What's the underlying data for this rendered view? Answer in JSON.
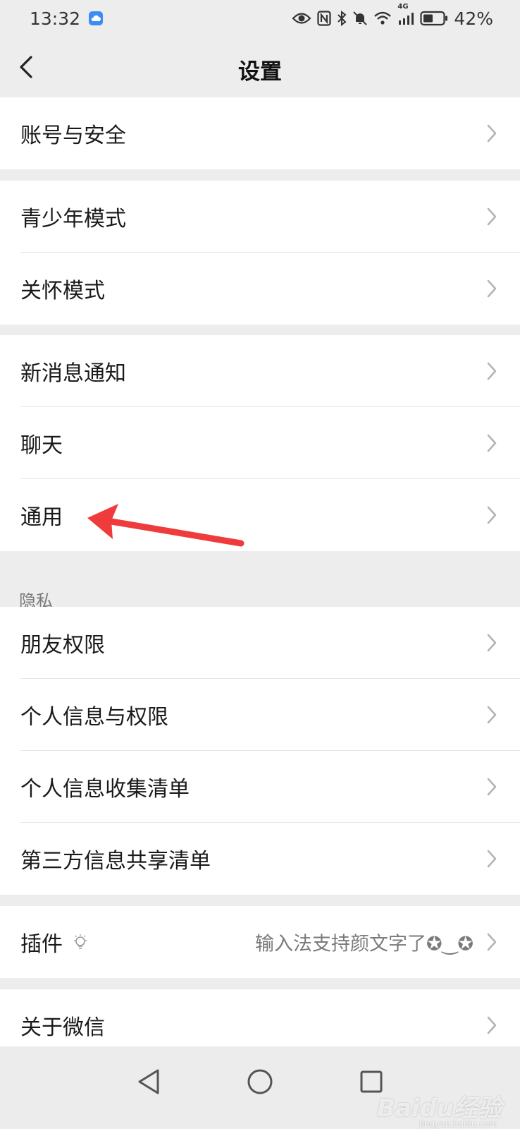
{
  "status_bar": {
    "time": "13:32",
    "battery": "42%",
    "network": "4G",
    "icons": [
      "cloud-icon",
      "eye-icon",
      "nfc-icon",
      "bluetooth-icon",
      "mute-icon",
      "wifi-icon",
      "signal-icon",
      "battery-icon"
    ]
  },
  "header": {
    "title": "设置"
  },
  "groups": {
    "account": {
      "items": [
        {
          "label": "账号与安全"
        }
      ]
    },
    "modes": {
      "items": [
        {
          "label": "青少年模式"
        },
        {
          "label": "关怀模式"
        }
      ]
    },
    "general": {
      "items": [
        {
          "label": "新消息通知"
        },
        {
          "label": "聊天"
        },
        {
          "label": "通用"
        }
      ]
    },
    "privacy": {
      "header": "隐私",
      "items": [
        {
          "label": "朋友权限"
        },
        {
          "label": "个人信息与权限"
        },
        {
          "label": "个人信息收集清单"
        },
        {
          "label": "第三方信息共享清单"
        }
      ]
    },
    "plugins": {
      "items": [
        {
          "label": "插件",
          "hint": "输入法支持颜文字了✪‿✪"
        }
      ]
    },
    "about": {
      "items": [
        {
          "label": "关于微信"
        }
      ]
    }
  },
  "watermark": {
    "text": "Baidu经验",
    "sub": "jingyan.baidu.com"
  },
  "colors": {
    "background": "#ededed",
    "annotation_arrow": "#ef3b3b",
    "accent_cloud": "#3b8cf5"
  }
}
